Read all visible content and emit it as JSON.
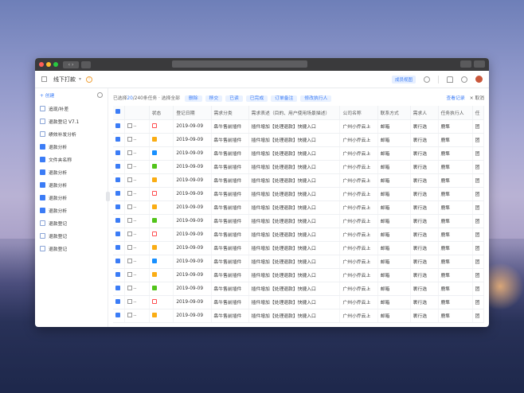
{
  "header": {
    "title": "线下打款",
    "badge": "成员视图"
  },
  "sidebar": {
    "create": "+ 创建",
    "items": [
      {
        "label": "追现/补差",
        "icon": "doc"
      },
      {
        "label": "退款登记 V7.1",
        "icon": "doc"
      },
      {
        "label": "绩效补发分析",
        "icon": "doc"
      },
      {
        "label": "退款分析",
        "icon": "folder"
      },
      {
        "label": "文件夹名称",
        "icon": "folder"
      },
      {
        "label": "退款分析",
        "icon": "folder"
      },
      {
        "label": "退款分析",
        "icon": "folder"
      },
      {
        "label": "退款分析",
        "icon": "folder"
      },
      {
        "label": "退款分析",
        "icon": "folder"
      },
      {
        "label": "退款登记",
        "icon": "doc"
      },
      {
        "label": "退款登记",
        "icon": "doc"
      },
      {
        "label": "退款登记",
        "icon": "doc"
      }
    ]
  },
  "toolbar": {
    "selected_prefix": "已选择",
    "selected_count": "20",
    "selected_suffix": "/240条任务 · 选择全部",
    "buttons": [
      "删除",
      "移交",
      "已读",
      "已完成",
      "订单备注",
      "修改执行人"
    ],
    "view_log": "查看记录",
    "cancel": "× 取消"
  },
  "table": {
    "headers": [
      "",
      "",
      "状态",
      "登记日期",
      "需求分类",
      "需求表述（目的、用户使用场景描述）",
      "公司名称",
      "联系方式",
      "需求人",
      "任务执行人",
      "任"
    ],
    "rows": [
      {
        "status": "red",
        "date": "2019-09-09",
        "category": "犇牛售前插件",
        "desc": "插件增加【处理退款】快捷入口",
        "company": "广州小乔云上",
        "contact": "邮箱",
        "requester": "裹行选",
        "assignee": "鹿隼",
        "extra": "团"
      },
      {
        "status": "orange",
        "date": "2019-09-09",
        "category": "犇牛售前插件",
        "desc": "插件增加【处理退款】快捷入口",
        "company": "广州小乔云上",
        "contact": "邮箱",
        "requester": "裹行选",
        "assignee": "鹿隼",
        "extra": "团"
      },
      {
        "status": "blue",
        "date": "2019-09-09",
        "category": "犇牛售前插件",
        "desc": "插件增加【处理退款】快捷入口",
        "company": "广州小乔云上",
        "contact": "邮箱",
        "requester": "裹行选",
        "assignee": "鹿隼",
        "extra": "团"
      },
      {
        "status": "green",
        "date": "2019-09-09",
        "category": "犇牛售前插件",
        "desc": "插件增加【处理退款】快捷入口",
        "company": "广州小乔云上",
        "contact": "邮箱",
        "requester": "裹行选",
        "assignee": "鹿隼",
        "extra": "团"
      },
      {
        "status": "orange",
        "date": "2019-09-09",
        "category": "犇牛售前插件",
        "desc": "插件增加【处理退款】快捷入口",
        "company": "广州小乔云上",
        "contact": "邮箱",
        "requester": "裹行选",
        "assignee": "鹿隼",
        "extra": "团"
      },
      {
        "status": "red",
        "date": "2019-09-09",
        "category": "犇牛售前插件",
        "desc": "插件增加【处理退款】快捷入口",
        "company": "广州小乔云上",
        "contact": "邮箱",
        "requester": "裹行选",
        "assignee": "鹿隼",
        "extra": "团"
      },
      {
        "status": "orange",
        "date": "2019-09-09",
        "category": "犇牛售前插件",
        "desc": "插件增加【处理退款】快捷入口",
        "company": "广州小乔云上",
        "contact": "邮箱",
        "requester": "裹行选",
        "assignee": "鹿隼",
        "extra": "团"
      },
      {
        "status": "green",
        "date": "2019-09-09",
        "category": "犇牛售前插件",
        "desc": "插件增加【处理退款】快捷入口",
        "company": "广州小乔云上",
        "contact": "邮箱",
        "requester": "裹行选",
        "assignee": "鹿隼",
        "extra": "团"
      },
      {
        "status": "red",
        "date": "2019-09-09",
        "category": "犇牛售前插件",
        "desc": "插件增加【处理退款】快捷入口",
        "company": "广州小乔云上",
        "contact": "邮箱",
        "requester": "裹行选",
        "assignee": "鹿隼",
        "extra": "团"
      },
      {
        "status": "orange",
        "date": "2019-09-09",
        "category": "犇牛售前插件",
        "desc": "插件增加【处理退款】快捷入口",
        "company": "广州小乔云上",
        "contact": "邮箱",
        "requester": "裹行选",
        "assignee": "鹿隼",
        "extra": "团"
      },
      {
        "status": "blue",
        "date": "2019-09-09",
        "category": "犇牛售前插件",
        "desc": "插件增加【处理退款】快捷入口",
        "company": "广州小乔云上",
        "contact": "邮箱",
        "requester": "裹行选",
        "assignee": "鹿隼",
        "extra": "团"
      },
      {
        "status": "orange",
        "date": "2019-09-09",
        "category": "犇牛售前插件",
        "desc": "插件增加【处理退款】快捷入口",
        "company": "广州小乔云上",
        "contact": "邮箱",
        "requester": "裹行选",
        "assignee": "鹿隼",
        "extra": "团"
      },
      {
        "status": "green",
        "date": "2019-09-09",
        "category": "犇牛售前插件",
        "desc": "插件增加【处理退款】快捷入口",
        "company": "广州小乔云上",
        "contact": "邮箱",
        "requester": "裹行选",
        "assignee": "鹿隼",
        "extra": "团"
      },
      {
        "status": "red",
        "date": "2019-09-09",
        "category": "犇牛售前插件",
        "desc": "插件增加【处理退款】快捷入口",
        "company": "广州小乔云上",
        "contact": "邮箱",
        "requester": "裹行选",
        "assignee": "鹿隼",
        "extra": "团"
      },
      {
        "status": "orange",
        "date": "2019-09-09",
        "category": "犇牛售前插件",
        "desc": "插件增加【处理退款】快捷入口",
        "company": "广州小乔云上",
        "contact": "邮箱",
        "requester": "裹行选",
        "assignee": "鹿隼",
        "extra": "团"
      }
    ]
  },
  "colors": {
    "accent": "#3b7cf6",
    "status_red": "#ff4d4f",
    "status_orange": "#faad14",
    "status_blue": "#1890ff",
    "status_green": "#52c41a"
  }
}
